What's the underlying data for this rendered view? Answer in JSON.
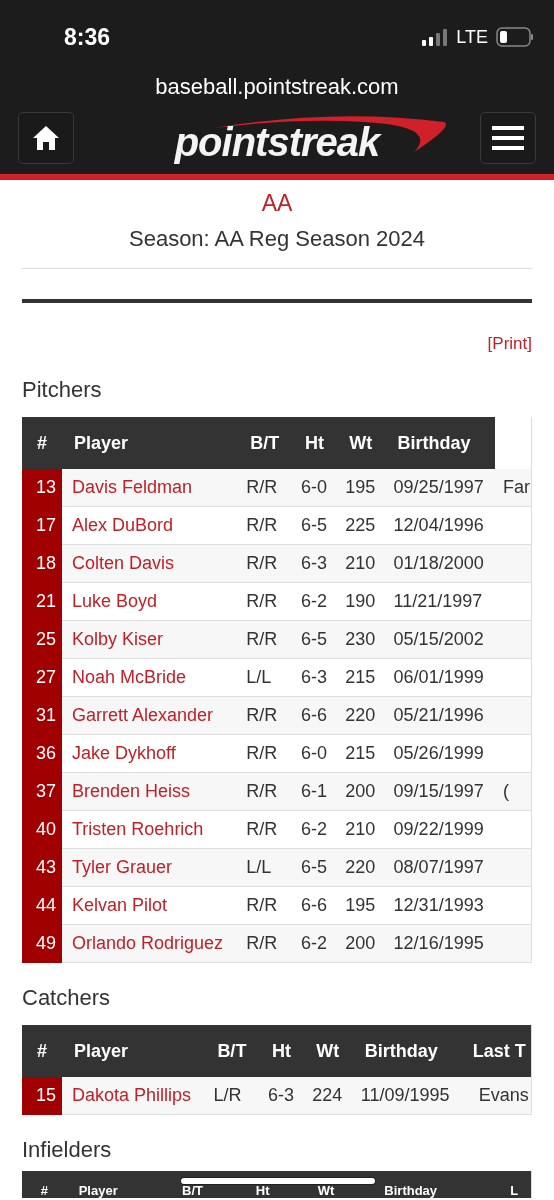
{
  "status_bar": {
    "time": "8:36",
    "network": "LTE"
  },
  "browser": {
    "url": "baseball.pointstreak.com"
  },
  "nav": {
    "logo_text": "pointstreak"
  },
  "league": {
    "value": "AA"
  },
  "season": "Season: AA Reg Season 2024",
  "print_link": "[Print]",
  "sections": [
    {
      "title": "Pitchers",
      "columns": [
        "#",
        "Player",
        "B/T",
        "Ht",
        "Wt",
        "Birthday"
      ],
      "rows": [
        {
          "cells": [
            "13",
            "Davis Feldman",
            "R/R",
            "6-0",
            "195",
            "09/25/1997",
            "Far"
          ]
        },
        {
          "cells": [
            "17",
            "Alex DuBord",
            "R/R",
            "6-5",
            "225",
            "12/04/1996"
          ]
        },
        {
          "cells": [
            "18",
            "Colten Davis",
            "R/R",
            "6-3",
            "210",
            "01/18/2000"
          ]
        },
        {
          "cells": [
            "21",
            "Luke Boyd",
            "R/R",
            "6-2",
            "190",
            "11/21/1997"
          ]
        },
        {
          "cells": [
            "25",
            "Kolby Kiser",
            "R/R",
            "6-5",
            "230",
            "05/15/2002"
          ]
        },
        {
          "cells": [
            "27",
            "Noah McBride",
            "L/L",
            "6-3",
            "215",
            "06/01/1999"
          ]
        },
        {
          "cells": [
            "31",
            "Garrett Alexander",
            "R/R",
            "6-6",
            "220",
            "05/21/1996"
          ]
        },
        {
          "cells": [
            "36",
            "Jake Dykhoff",
            "R/R",
            "6-0",
            "215",
            "05/26/1999"
          ]
        },
        {
          "cells": [
            "37",
            "Brenden Heiss",
            "R/R",
            "6-1",
            "200",
            "09/15/1997",
            "("
          ]
        },
        {
          "cells": [
            "40",
            "Tristen Roehrich",
            "R/R",
            "6-2",
            "210",
            "09/22/1999"
          ]
        },
        {
          "cells": [
            "43",
            "Tyler Grauer",
            "L/L",
            "6-5",
            "220",
            "08/07/1997"
          ]
        },
        {
          "cells": [
            "44",
            "Kelvan Pilot",
            "R/R",
            "6-6",
            "195",
            "12/31/1993"
          ]
        },
        {
          "cells": [
            "49",
            "Orlando Rodriguez",
            "R/R",
            "6-2",
            "200",
            "12/16/1995"
          ]
        }
      ]
    },
    {
      "title": "Catchers",
      "columns": [
        "#",
        "Player",
        "B/T",
        "Ht",
        "Wt",
        "Birthday",
        "Last T"
      ],
      "rows": [
        {
          "cells": [
            "15",
            "Dakota Phillips",
            "L/R",
            "6-3",
            "224",
            "11/09/1995",
            "Evans"
          ]
        }
      ]
    },
    {
      "title": "Infielders",
      "columns": [
        "#",
        "Player",
        "B/T",
        "Ht",
        "Wt",
        "Birthday",
        "L"
      ]
    }
  ]
}
